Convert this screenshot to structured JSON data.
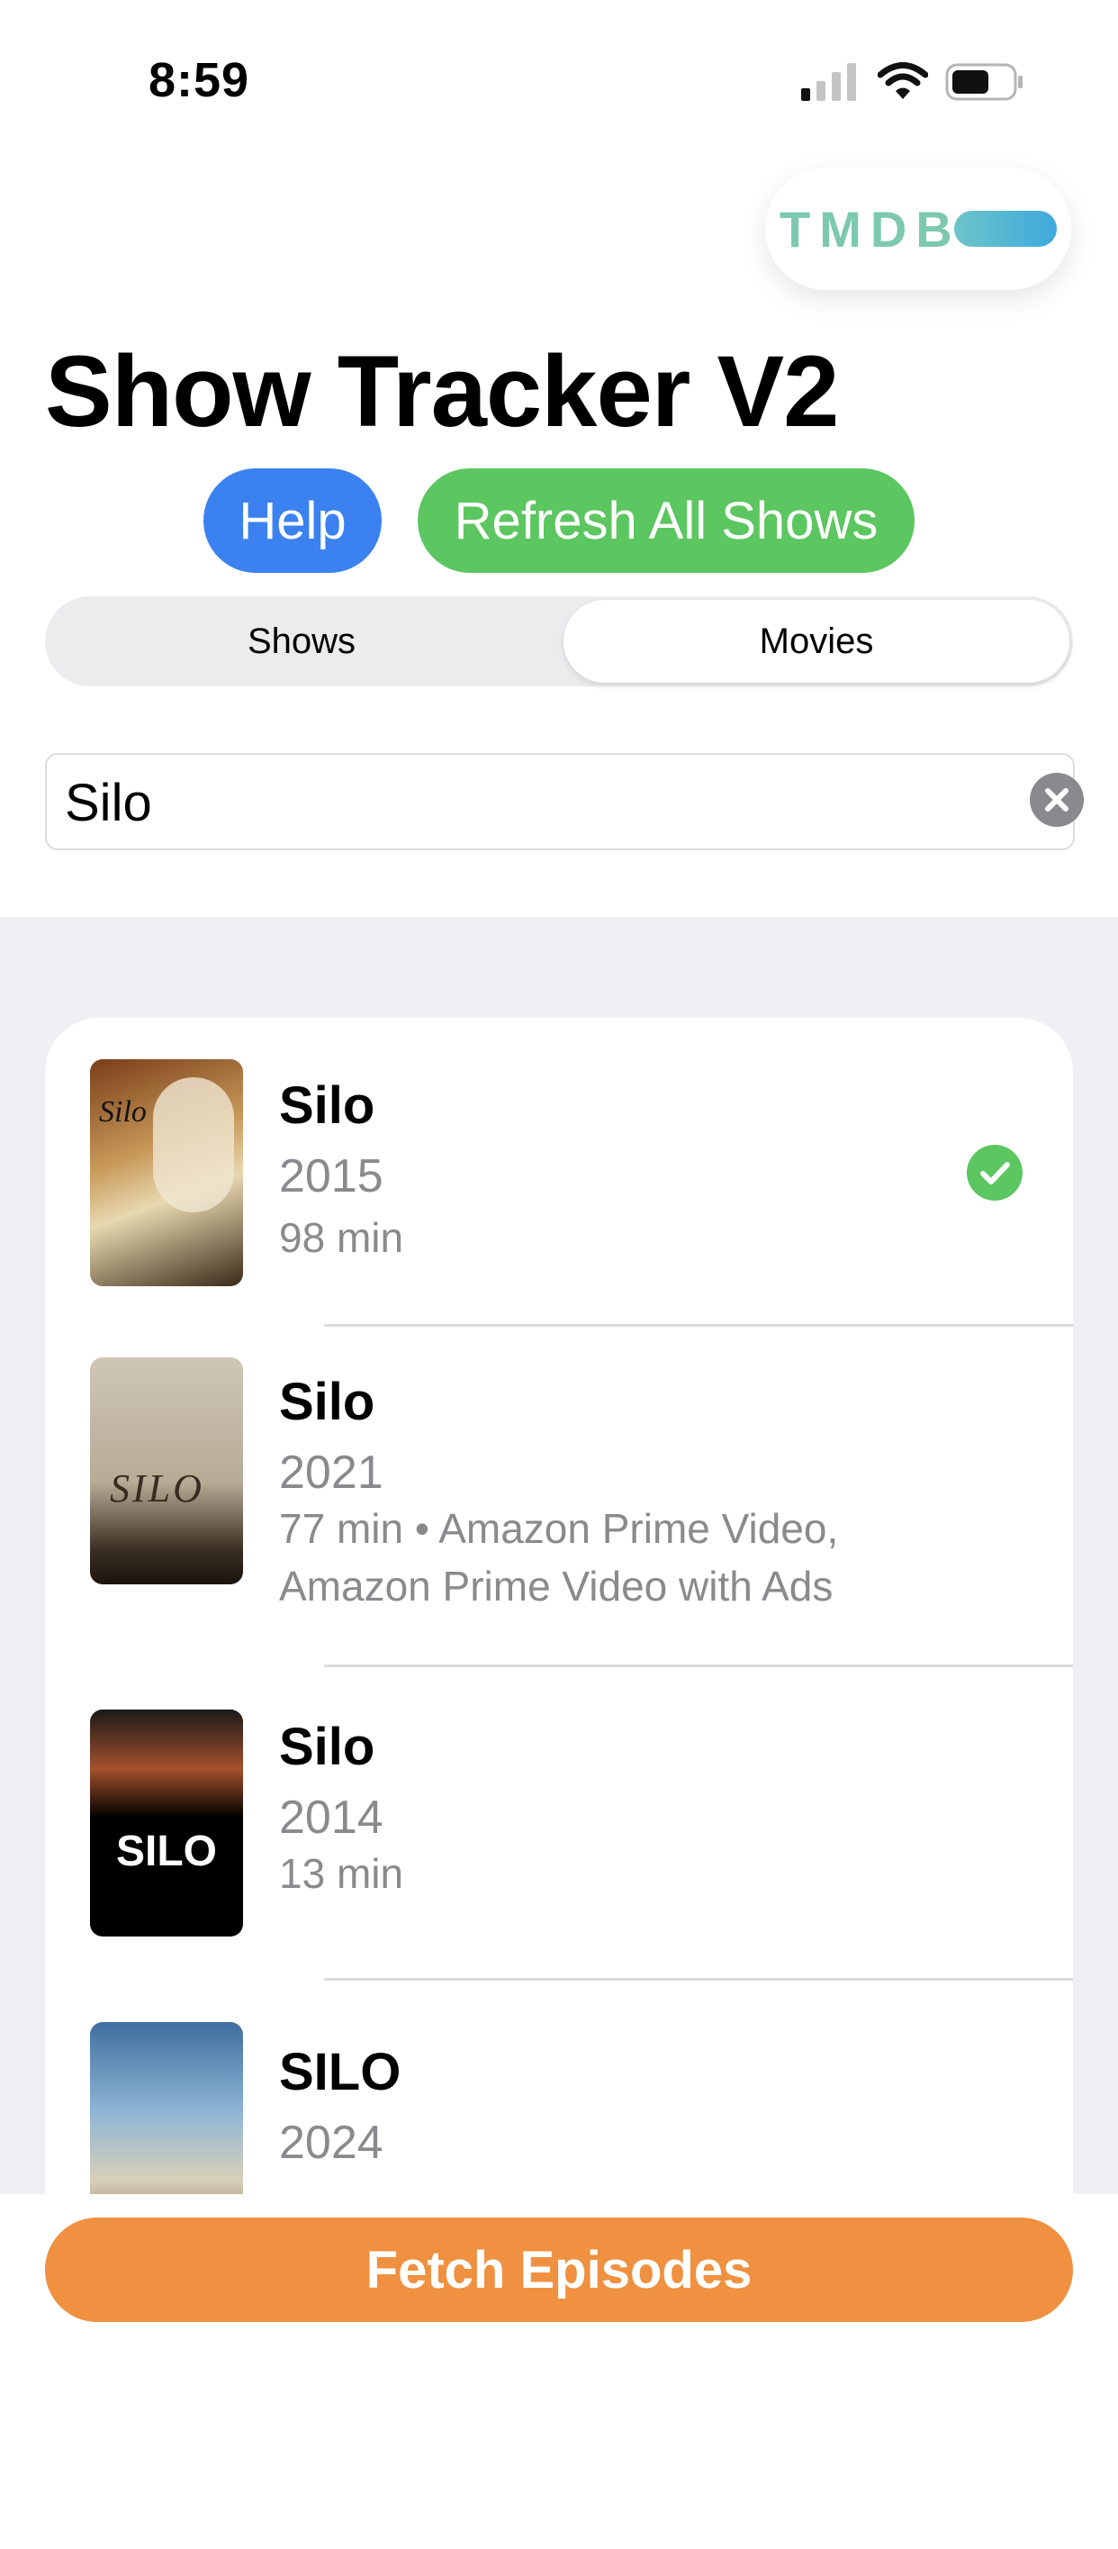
{
  "status_bar": {
    "time": "8:59"
  },
  "tmdb_logo": {
    "text": "TMDB"
  },
  "header": {
    "title": "Show Tracker V2"
  },
  "actions": {
    "help_label": "Help",
    "refresh_label": "Refresh All Shows"
  },
  "tabs": [
    {
      "label": "Shows",
      "selected": false
    },
    {
      "label": "Movies",
      "selected": true
    }
  ],
  "search": {
    "value": "Silo"
  },
  "results": [
    {
      "title": "Silo",
      "year": "2015",
      "meta": "98 min",
      "meta2": "",
      "checked": true
    },
    {
      "title": "Silo",
      "year": "2021",
      "meta": "77 min • Amazon Prime Video,",
      "meta2": "Amazon Prime Video with Ads",
      "checked": false
    },
    {
      "title": "Silo",
      "year": "2014",
      "meta": "13 min",
      "meta2": "",
      "checked": false
    },
    {
      "title": "SILO",
      "year": "2024",
      "meta": "",
      "meta2": "",
      "checked": false
    }
  ],
  "posters": {
    "p1_text": "Silo",
    "p2_text": "SILO",
    "p3_text": "SILO"
  },
  "footer": {
    "fetch_label": "Fetch Episodes"
  },
  "colors": {
    "help": "#3b82f0",
    "refresh": "#5cc660",
    "fetch": "#ef9140",
    "check": "#5cc660"
  }
}
